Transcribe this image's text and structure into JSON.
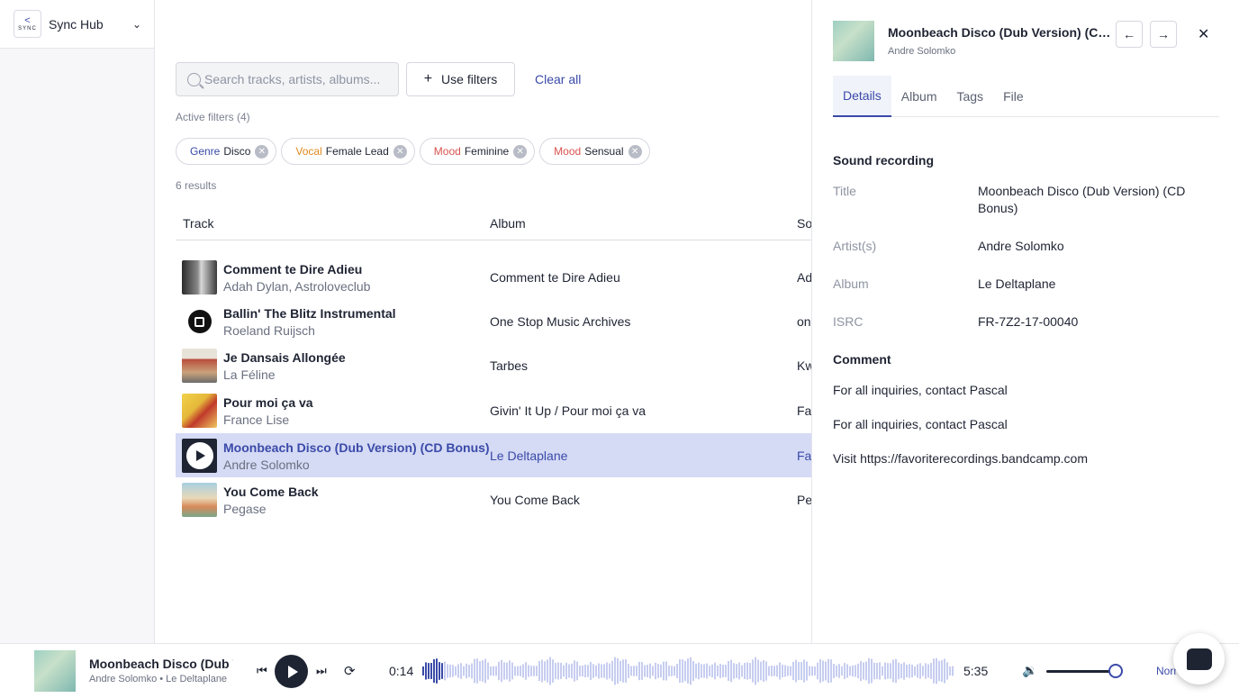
{
  "brand": {
    "logo_text": "SYNC",
    "name": "Sync Hub"
  },
  "search": {
    "placeholder": "Search tracks, artists, albums..."
  },
  "toolbar": {
    "use_filters_label": "Use filters",
    "clear_all_label": "Clear all"
  },
  "active_filters_label": "Active filters (4)",
  "chips": [
    {
      "key": "Genre",
      "value": "Disco",
      "color": "#3a4aa8"
    },
    {
      "key": "Vocal",
      "value": "Female Lead",
      "color": "#e08a1e"
    },
    {
      "key": "Mood",
      "value": "Feminine",
      "color": "#d9534f"
    },
    {
      "key": "Mood",
      "value": "Sensual",
      "color": "#d9534f"
    }
  ],
  "results_label": "6 results",
  "table": {
    "headers": {
      "track": "Track",
      "album": "Album",
      "source": "So"
    },
    "rows": [
      {
        "title": "Comment te Dire Adieu",
        "artist": "Adah Dylan, Astroloveclub",
        "album": "Comment te Dire Adieu",
        "source": "Ad"
      },
      {
        "title": "Ballin' The Blitz Instrumental",
        "artist": "Roeland Ruijsch",
        "album": "One Stop Music Archives",
        "source": "on"
      },
      {
        "title": "Je Dansais Allongée",
        "artist": "La Féline",
        "album": "Tarbes",
        "source": "Kw"
      },
      {
        "title": "Pour moi ça va",
        "artist": "France Lise",
        "album": "Givin' It Up / Pour moi ça va",
        "source": "Fa"
      },
      {
        "title": "Moonbeach Disco (Dub Version) (CD Bonus)",
        "artist": "Andre Solomko",
        "album": "Le Deltaplane",
        "source": "Fa"
      },
      {
        "title": "You Come Back",
        "artist": "Pegase",
        "album": "You Come Back",
        "source": "Pe"
      }
    ]
  },
  "panel": {
    "title": "Moonbeach Disco (Dub Version) (CD Bonus)",
    "artist": "Andre Solomko",
    "tabs": [
      "Details",
      "Album",
      "Tags",
      "File"
    ],
    "section_recording": "Sound recording",
    "fields": {
      "title_label": "Title",
      "title_value": "Moonbeach Disco (Dub Version) (CD Bonus)",
      "artists_label": "Artist(s)",
      "artists_value": "Andre Solomko",
      "album_label": "Album",
      "album_value": "Le Deltaplane",
      "isrc_label": "ISRC",
      "isrc_value": "FR-7Z2-17-00040"
    },
    "section_comment": "Comment",
    "comments": [
      "For all inquiries, contact Pascal",
      "For all inquiries, contact Pascal",
      "Visit https://favoriterecordings.bandcamp.com"
    ]
  },
  "player": {
    "title": "Moonbeach Disco (Dub Version) (CD Bonus)",
    "subtitle": "Andre Solomko • Le Deltaplane",
    "current_time": "0:14",
    "duration": "5:35",
    "progress": 0.04,
    "volume": 0.92,
    "speed_label": "Normal"
  }
}
